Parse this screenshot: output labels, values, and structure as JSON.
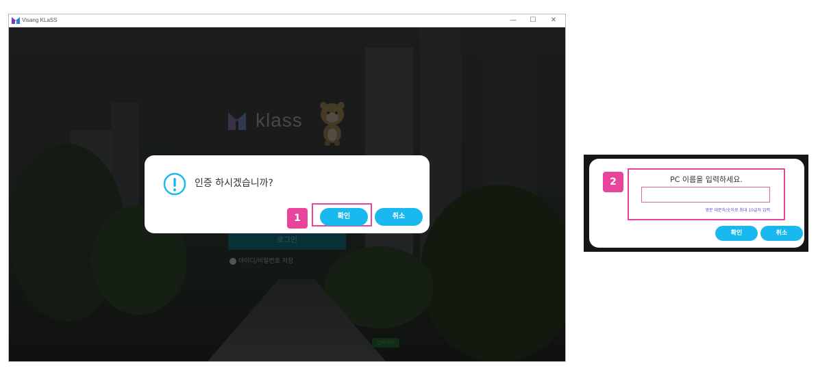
{
  "window": {
    "title": "Visang KLaSS",
    "minimize_glyph": "—",
    "maximize_glyph": "☐",
    "close_glyph": "✕"
  },
  "background": {
    "logo_text": "klass",
    "login_label": "로그인",
    "remember_label": "아이디/비밀번호 저장",
    "footer_text": "",
    "footer_button": "입력하기"
  },
  "dialog1": {
    "message": "인증 하시겠습니까?",
    "ok_label": "확인",
    "cancel_label": "취소",
    "step": "1"
  },
  "dialog2": {
    "step": "2",
    "title": "PC 이름을 입력하세요.",
    "input_value": "",
    "hint": "영문 대문자/숫자로 최대 10글자 입력.",
    "ok_label": "확인",
    "cancel_label": "취소"
  },
  "colors": {
    "accent": "#19b8ef",
    "highlight": "#e8449b",
    "dim_bg": "#151515"
  }
}
